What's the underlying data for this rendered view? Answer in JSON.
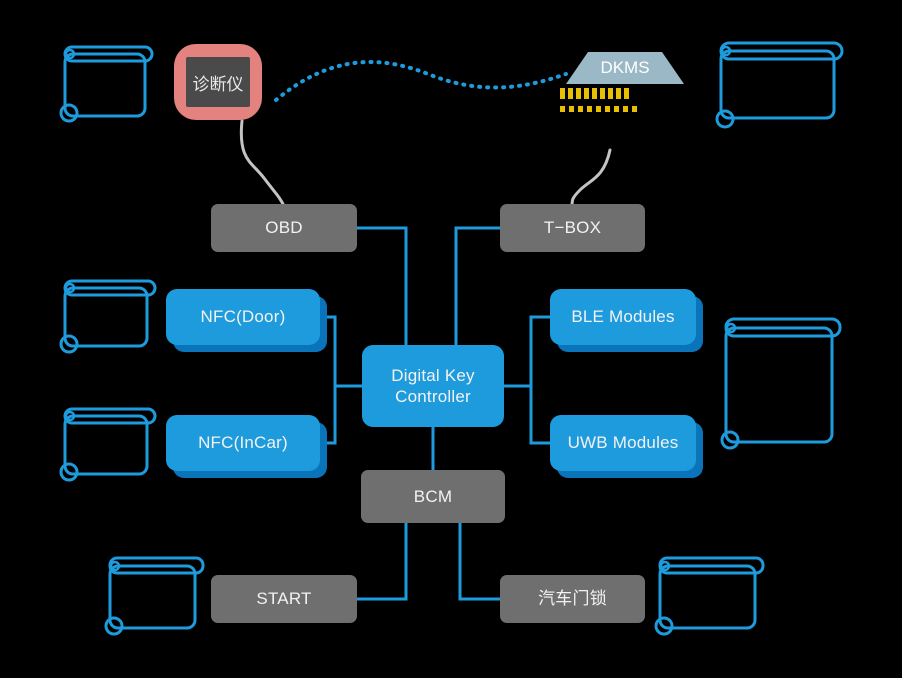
{
  "diagram": {
    "title": "Digital Key System Architecture",
    "background_color": "#000000",
    "colors": {
      "blue_node": "#1e9bdd",
      "blue_node_shadow": "#0a74bb",
      "gray_node": "#6f6f6f",
      "connector_blue": "#1e9bdd",
      "cable_gray": "#c3c3c3",
      "device_frame_red": "#e3827f",
      "device_screen_gray": "#4a4a4a",
      "dkms_fill": "#9ab8c6",
      "led_yellow": "#e8c000",
      "scroll_outline": "#1e9bdd",
      "text": "#f2f2f2"
    },
    "nodes": [
      {
        "id": "diagnostic-tool",
        "label": "诊断仪",
        "style": "device"
      },
      {
        "id": "dkms",
        "label": "DKMS",
        "style": "server"
      },
      {
        "id": "obd",
        "label": "OBD",
        "style": "gray"
      },
      {
        "id": "tbox",
        "label": "T−BOX",
        "style": "gray"
      },
      {
        "id": "nfc-door",
        "label": "NFC(Door)",
        "style": "blue-3d"
      },
      {
        "id": "nfc-incar",
        "label": "NFC(InCar)",
        "style": "blue-3d"
      },
      {
        "id": "digital-key-controller",
        "label": "Digital Key\nController",
        "label_line1": "Digital Key",
        "label_line2": "Controller",
        "style": "blue"
      },
      {
        "id": "ble-modules",
        "label": "BLE Modules",
        "style": "blue-3d"
      },
      {
        "id": "uwb-modules",
        "label": "UWB Modules",
        "style": "blue-3d"
      },
      {
        "id": "bcm",
        "label": "BCM",
        "style": "gray"
      },
      {
        "id": "start",
        "label": "START",
        "style": "gray"
      },
      {
        "id": "car-door-lock",
        "label": "汽车门锁",
        "style": "gray"
      }
    ],
    "labels": {
      "diagnostic_tool": "诊断仪",
      "dkms": "DKMS",
      "obd": "OBD",
      "tbox": "T−BOX",
      "nfc_door": "NFC(Door)",
      "nfc_incar": "NFC(InCar)",
      "dkc_line1": "Digital Key",
      "dkc_line2": "Controller",
      "ble_modules": "BLE Modules",
      "uwb_modules": "UWB Modules",
      "bcm": "BCM",
      "start": "START",
      "car_door_lock": "汽车门锁"
    },
    "connections": [
      {
        "from": "diagnostic-tool",
        "to": "dkms",
        "style": "dotted-wave",
        "color": "#1e9bdd"
      },
      {
        "from": "diagnostic-tool",
        "to": "obd",
        "style": "gray-cable",
        "color": "#c3c3c3"
      },
      {
        "from": "dkms",
        "to": "tbox",
        "style": "gray-cable",
        "color": "#c3c3c3"
      },
      {
        "from": "obd",
        "to": "digital-key-controller",
        "style": "orthogonal",
        "color": "#1e9bdd"
      },
      {
        "from": "tbox",
        "to": "digital-key-controller",
        "style": "orthogonal",
        "color": "#1e9bdd"
      },
      {
        "from": "nfc-door",
        "to": "digital-key-controller",
        "style": "bracket-left",
        "color": "#1e9bdd"
      },
      {
        "from": "nfc-incar",
        "to": "digital-key-controller",
        "style": "bracket-left",
        "color": "#1e9bdd"
      },
      {
        "from": "digital-key-controller",
        "to": "ble-modules",
        "style": "bracket-right",
        "color": "#1e9bdd"
      },
      {
        "from": "digital-key-controller",
        "to": "uwb-modules",
        "style": "bracket-right",
        "color": "#1e9bdd"
      },
      {
        "from": "digital-key-controller",
        "to": "bcm",
        "style": "straight",
        "color": "#1e9bdd"
      },
      {
        "from": "bcm",
        "to": "start",
        "style": "orthogonal",
        "color": "#1e9bdd"
      },
      {
        "from": "bcm",
        "to": "car-door-lock",
        "style": "orthogonal",
        "color": "#1e9bdd"
      }
    ],
    "decorations": {
      "scroll_icons_count": 8,
      "dkms_led_rows": 2,
      "dkms_leds_per_row": 9
    }
  }
}
